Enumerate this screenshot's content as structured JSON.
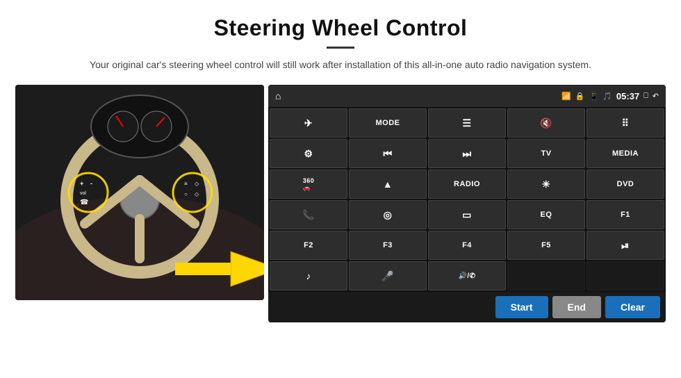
{
  "header": {
    "title": "Steering Wheel Control",
    "subtitle": "Your original car's steering wheel control will still work after installation of this all-in-one auto radio navigation system."
  },
  "status_bar": {
    "time": "05:37",
    "icons": [
      "wifi",
      "lock",
      "sim",
      "bluetooth",
      "cast",
      "back"
    ]
  },
  "grid_buttons": [
    {
      "id": "r1c1",
      "label": "⌂",
      "type": "icon"
    },
    {
      "id": "r1c2",
      "label": "✈",
      "type": "icon"
    },
    {
      "id": "r1c3",
      "label": "MODE",
      "type": "text"
    },
    {
      "id": "r1c4",
      "label": "≡",
      "type": "icon"
    },
    {
      "id": "r1c5",
      "label": "🔇",
      "type": "icon"
    },
    {
      "id": "r1c6",
      "label": "⠿",
      "type": "icon"
    },
    {
      "id": "r2c1",
      "label": "⚙",
      "type": "icon"
    },
    {
      "id": "r2c2",
      "label": "⏮",
      "type": "icon"
    },
    {
      "id": "r2c3",
      "label": "⏭",
      "type": "icon"
    },
    {
      "id": "r2c4",
      "label": "TV",
      "type": "text"
    },
    {
      "id": "r2c5",
      "label": "MEDIA",
      "type": "text"
    },
    {
      "id": "r3c1",
      "label": "360",
      "type": "text-small"
    },
    {
      "id": "r3c2",
      "label": "▲",
      "type": "icon"
    },
    {
      "id": "r3c3",
      "label": "RADIO",
      "type": "text"
    },
    {
      "id": "r3c4",
      "label": "☀",
      "type": "icon"
    },
    {
      "id": "r3c5",
      "label": "DVD",
      "type": "text"
    },
    {
      "id": "r4c1",
      "label": "📞",
      "type": "icon"
    },
    {
      "id": "r4c2",
      "label": "◎",
      "type": "icon"
    },
    {
      "id": "r4c3",
      "label": "▭",
      "type": "icon"
    },
    {
      "id": "r4c4",
      "label": "EQ",
      "type": "text"
    },
    {
      "id": "r4c5",
      "label": "F1",
      "type": "text"
    },
    {
      "id": "r5c1",
      "label": "F2",
      "type": "text"
    },
    {
      "id": "r5c2",
      "label": "F3",
      "type": "text"
    },
    {
      "id": "r5c3",
      "label": "F4",
      "type": "text"
    },
    {
      "id": "r5c4",
      "label": "F5",
      "type": "text"
    },
    {
      "id": "r5c5",
      "label": "⏯",
      "type": "icon"
    },
    {
      "id": "r6c1",
      "label": "♪",
      "type": "icon"
    },
    {
      "id": "r6c2",
      "label": "🎤",
      "type": "icon"
    },
    {
      "id": "r6c3",
      "label": "🔊/✆",
      "type": "icon"
    },
    {
      "id": "r6c4",
      "label": "",
      "type": "empty"
    },
    {
      "id": "r6c5",
      "label": "",
      "type": "empty"
    }
  ],
  "bottom_buttons": {
    "start": "Start",
    "end": "End",
    "clear": "Clear"
  }
}
